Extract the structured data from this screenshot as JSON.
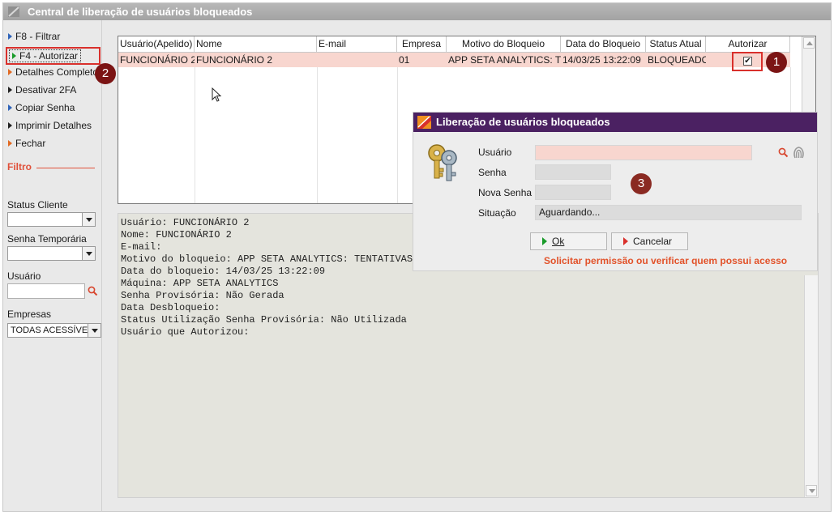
{
  "window": {
    "title": "Central de liberação de usuários bloqueados"
  },
  "sidebar": {
    "items": [
      {
        "label": "F8 - Filtrar",
        "icon": "blue-arrow-icon"
      },
      {
        "label": "F4 - Autorizar",
        "icon": "green-arrow-icon"
      },
      {
        "label": "Detalhes Completos",
        "icon": "orange-arrow-icon"
      },
      {
        "label": "Desativar 2FA",
        "icon": "black-arrow-icon"
      },
      {
        "label": "Copiar Senha",
        "icon": "blue-arrow-icon"
      },
      {
        "label": "Imprimir Detalhes",
        "icon": "black-arrow-icon"
      },
      {
        "label": "Fechar",
        "icon": "orange-arrow-icon"
      }
    ],
    "filtro_label": "Filtro",
    "status_cliente_label": "Status Cliente",
    "senha_temporaria_label": "Senha Temporária",
    "usuario_label": "Usuário",
    "empresas_label": "Empresas",
    "empresas_value": "TODAS ACESSÍVEIS"
  },
  "grid": {
    "columns": [
      "Usuário(Apelido)",
      "Nome",
      "E-mail",
      "Empresa",
      "Motivo do Bloqueio",
      "Data do Bloqueio",
      "Status Atual",
      "Autorizar"
    ],
    "rows": [
      {
        "apelido": "FUNCIONÁRIO 2",
        "nome": "FUNCIONÁRIO 2",
        "email": "",
        "empresa": "01",
        "motivo": "APP SETA ANALYTICS: TENTATIVAS",
        "data": "14/03/25 13:22:09",
        "status": "BLOQUEADO",
        "autorizar": "✔"
      }
    ]
  },
  "details": {
    "lines": [
      "Usuário: FUNCIONÁRIO 2",
      "Nome: FUNCIONÁRIO 2",
      "E-mail:",
      "Motivo do bloqueio: APP SETA ANALYTICS: TENTATIVAS",
      "Data do bloqueio: 14/03/25 13:22:09",
      "Máquina: APP SETA ANALYTICS",
      "Senha Provisória: Não Gerada",
      "Data Desbloqueio:",
      "Status Utilização Senha Provisória: Não Utilizada",
      "Usuário que Autorizou:"
    ]
  },
  "dialog": {
    "title": "Liberação de usuários bloqueados",
    "usuario_label": "Usuário",
    "senha_label": "Senha",
    "nova_senha_label": "Nova Senha",
    "situacao_label": "Situação",
    "situacao_value": "Aguardando...",
    "ok_label": "Ok",
    "cancel_label": "Cancelar",
    "warning": "Solicitar permissão ou verificar quem possui acesso"
  },
  "badges": [
    "1",
    "2",
    "3"
  ],
  "colors": {
    "accent_red": "#d9302c",
    "dialog_title_bg": "#4b2162",
    "selected_row": "#f8d6cf",
    "warning_text": "#e2522a"
  }
}
